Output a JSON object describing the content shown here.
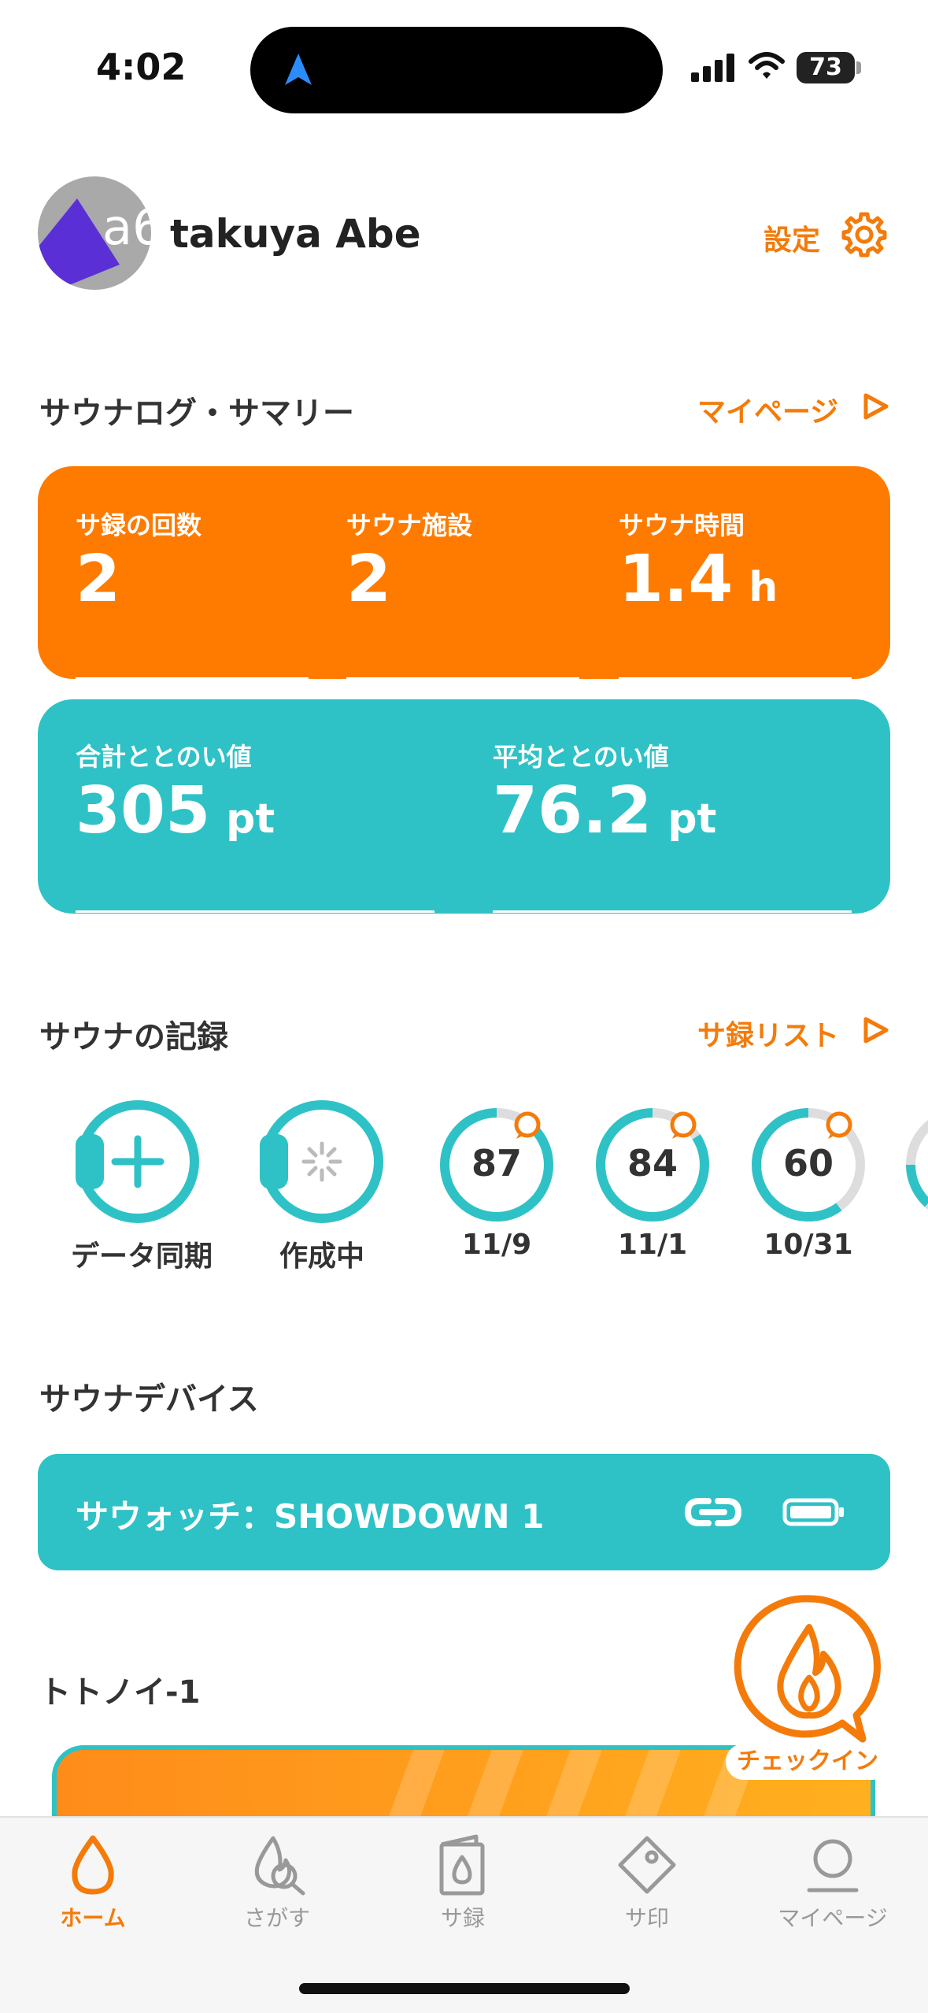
{
  "status_bar": {
    "time": "4:02",
    "battery": "73"
  },
  "profile": {
    "avatar_text": "a6",
    "name": "takuya Abe",
    "settings_label": "設定"
  },
  "summary": {
    "title": "サウナログ・サマリー",
    "link": "マイページ",
    "stats": [
      {
        "label": "サ録の回数",
        "value": "2",
        "unit": ""
      },
      {
        "label": "サウナ施設",
        "value": "2",
        "unit": ""
      },
      {
        "label": "サウナ時間",
        "value": "1.4",
        "unit": "h"
      }
    ],
    "totonoi": [
      {
        "label": "合計ととのい値",
        "value": "305",
        "unit": "pt"
      },
      {
        "label": "平均ととのい値",
        "value": "76.2",
        "unit": "pt"
      }
    ]
  },
  "records": {
    "title": "サウナの記録",
    "link": "サ録リスト",
    "sync_label": "データ同期",
    "creating_label": "作成中",
    "items": [
      {
        "score": "87",
        "date": "11/9",
        "fraction": 0.87
      },
      {
        "score": "84",
        "date": "11/1",
        "fraction": 0.84
      },
      {
        "score": "60",
        "date": "10/31",
        "fraction": 0.6
      }
    ]
  },
  "device": {
    "title": "サウナデバイス",
    "name": "サウォッチ：SHOWDOWN 1"
  },
  "totonoi_section": {
    "title": "トトノイ-1"
  },
  "checkin": {
    "label": "チェックイン"
  },
  "tabs": [
    {
      "label": "ホーム",
      "icon": "drop-icon",
      "active": true
    },
    {
      "label": "さがす",
      "icon": "fire-search-icon",
      "active": false
    },
    {
      "label": "サ録",
      "icon": "book-drop-icon",
      "active": false
    },
    {
      "label": "サ印",
      "icon": "stamp-icon",
      "active": false
    },
    {
      "label": "マイページ",
      "icon": "person-icon",
      "active": false
    }
  ],
  "colors": {
    "accent": "#f47b0a",
    "orange_card": "#ff7b00",
    "teal": "#2ec2c6",
    "nav_blue": "#2a8cff"
  }
}
